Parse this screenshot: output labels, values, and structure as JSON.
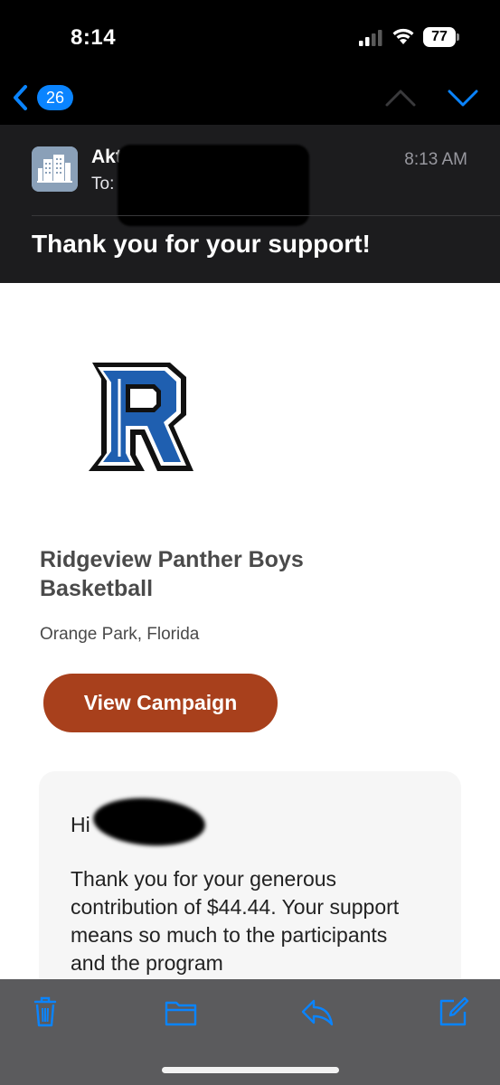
{
  "status_bar": {
    "time": "8:14",
    "battery_level": "77"
  },
  "nav": {
    "back_count": "26"
  },
  "header": {
    "sender_name": "Akti",
    "to_label": "To:",
    "time": "8:13 AM",
    "subject": "Thank you for your support!"
  },
  "body": {
    "org_name": "Ridgeview Panther Boys Basketball",
    "location": "Orange Park, Florida",
    "button_label": "View Campaign",
    "greeting": "Hi",
    "message": "Thank you for your generous contribution of $44.44. Your support means so much to the participants and the program"
  },
  "toolbar": {
    "icons": [
      "trash-icon",
      "folder-icon",
      "reply-icon",
      "compose-icon"
    ]
  },
  "colors": {
    "accent": "#0a84ff",
    "button": "#a8401c",
    "logo_blue": "#1f5fb0"
  }
}
